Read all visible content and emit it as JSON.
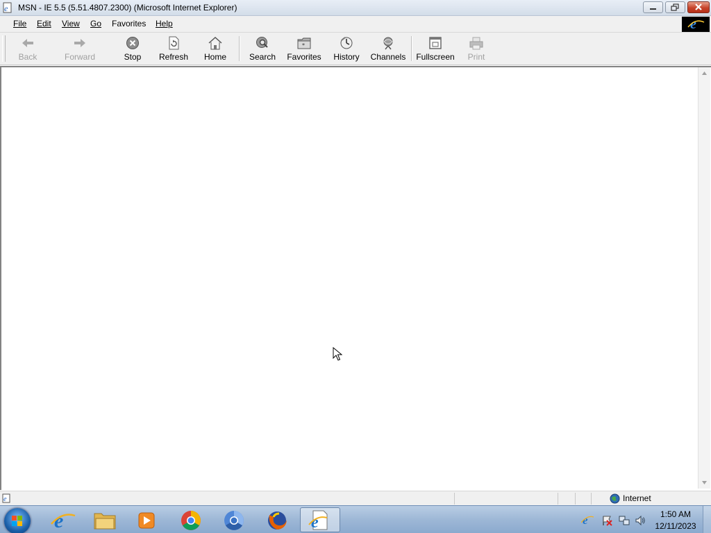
{
  "window": {
    "title": "MSN - IE 5.5 (5.51.4807.2300) (Microsoft Internet Explorer)"
  },
  "menu": [
    {
      "label": "File",
      "accel": "F"
    },
    {
      "label": "Edit",
      "accel": "E"
    },
    {
      "label": "View",
      "accel": "V"
    },
    {
      "label": "Go",
      "accel": "G"
    },
    {
      "label": "Favorites",
      "accel": "a"
    },
    {
      "label": "Help",
      "accel": "H"
    }
  ],
  "toolbar": {
    "back": {
      "label": "Back",
      "icon": "back-arrow-icon",
      "enabled": false
    },
    "forward": {
      "label": "Forward",
      "icon": "forward-arrow-icon",
      "enabled": false
    },
    "stop": {
      "label": "Stop",
      "icon": "stop-icon",
      "enabled": true
    },
    "refresh": {
      "label": "Refresh",
      "icon": "refresh-icon",
      "enabled": true
    },
    "home": {
      "label": "Home",
      "icon": "home-icon",
      "enabled": true
    },
    "search": {
      "label": "Search",
      "icon": "search-globe-icon",
      "enabled": true
    },
    "favorites": {
      "label": "Favorites",
      "icon": "favorites-folder-icon",
      "enabled": true
    },
    "history": {
      "label": "History",
      "icon": "history-icon",
      "enabled": true
    },
    "channels": {
      "label": "Channels",
      "icon": "channels-icon",
      "enabled": true
    },
    "fullscreen": {
      "label": "Fullscreen",
      "icon": "fullscreen-icon",
      "enabled": true
    },
    "print": {
      "label": "Print",
      "icon": "print-icon",
      "enabled": false
    }
  },
  "statusbar": {
    "zone": "Internet"
  },
  "taskbar": {
    "apps": [
      "internet-explorer",
      "file-explorer",
      "media-player",
      "chrome",
      "chromium",
      "firefox",
      "internet-explorer-document"
    ],
    "active_app": "internet-explorer-document",
    "clock": {
      "time": "1:50 AM",
      "date": "12/11/2023"
    }
  },
  "colors": {
    "titlebar": "#dbe4ee",
    "chrome": "#f0f0f0",
    "taskbar": "#9db7d6",
    "close_button": "#c7442b"
  }
}
